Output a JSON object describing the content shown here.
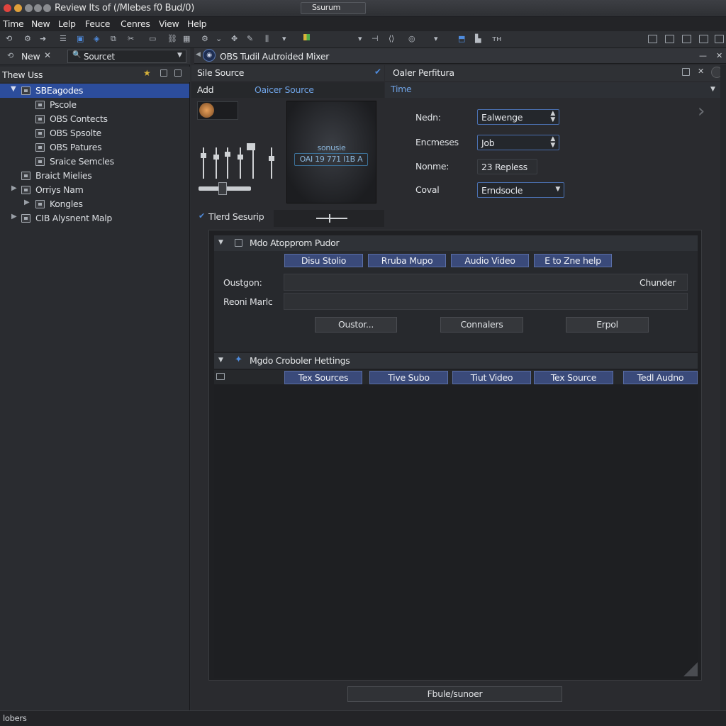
{
  "window": {
    "title": "Review Its of (/Mlebes f0 Bud/0)"
  },
  "menu": [
    "Time",
    "New",
    "Lelp",
    "Feuce",
    "Cenres",
    "View",
    "Help"
  ],
  "toolbar": {
    "scene_label": "Ssurum"
  },
  "left": {
    "new_label": "New",
    "source_combo": "Sourcet",
    "tree_title": "Thew Uss",
    "items": [
      {
        "label": "SBEagodes",
        "selected": true
      },
      {
        "label": "Pscole"
      },
      {
        "label": "OBS Contects"
      },
      {
        "label": "OBS Spsolte"
      },
      {
        "label": "OBS Patures"
      },
      {
        "label": "Sraice Semcles"
      },
      {
        "label": "Braict Mielies"
      },
      {
        "label": "Orriys Nam"
      },
      {
        "label": "Kongles"
      },
      {
        "label": "CIB Alysnent Malp"
      }
    ]
  },
  "mixer": {
    "tab_title": "OBS Tudil Autroided Mixer",
    "source_header": "Sile Source",
    "filters_header": "Oaler Perfitura",
    "add_label": "Add",
    "other_source": "Oaicer Source",
    "time_label": "Time",
    "preview_title": "sonusie",
    "preview_readout": "OAI 19 771 I1B A",
    "tiered_label": "Tlerd Sesurip"
  },
  "fields": [
    {
      "label": "Nedn:",
      "value": "Ealwenge"
    },
    {
      "label": "Encmeses",
      "value": "Job"
    },
    {
      "label": "Nonme:",
      "value": "23 Repless"
    },
    {
      "label": "Coval",
      "value": "Erndsocle"
    }
  ],
  "section1": {
    "title": "Mdo Atopprom Pudor",
    "buttons": [
      "Disu Stolio",
      "Rruba Mupo",
      "Audio Video",
      "E to Zne help"
    ],
    "question_label": "Oustgon:",
    "question_value": "Chunder",
    "remark_label": "Reoni Marlc",
    "actions": [
      "Oustor...",
      "Connalers",
      "Erpol"
    ]
  },
  "section2": {
    "title": "Mgdo Croboler Hettings",
    "tabs": [
      "Tex Sources",
      "Tive Subo",
      "Tiut Video",
      "Tex Source",
      "Tedl Audno"
    ]
  },
  "bottom_button": "Fbule/sunoer",
  "status": "lobers",
  "colors": {
    "selection": "#2c4d9c",
    "accent_button": "#3a4a7a",
    "field_border": "#4a6fae"
  }
}
